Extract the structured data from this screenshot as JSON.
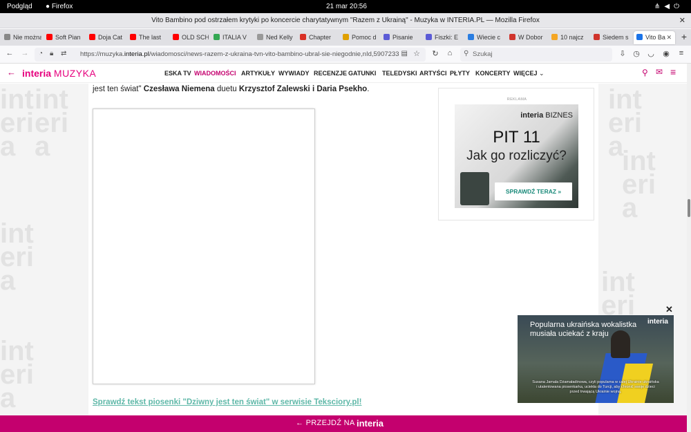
{
  "system": {
    "activities": "Podgląd",
    "app_name": "Firefox",
    "clock": "21 mar  20:56"
  },
  "window": {
    "title": "Vito Bambino pod ostrzałem krytyki po koncercie charytatywnym \"Razem z Ukrainą\" - Muzyka w INTERIA.PL — Mozilla Firefox",
    "close": "✕"
  },
  "tabs": [
    {
      "label": "Nie można p",
      "color": "#888888"
    },
    {
      "label": "Soft Pian",
      "color": "#ff0000"
    },
    {
      "label": "Doja Cat",
      "color": "#ff0000"
    },
    {
      "label": "The last",
      "color": "#ff0000"
    },
    {
      "label": "OLD SCH",
      "color": "#ff0000"
    },
    {
      "label": "ITALIA V",
      "color": "#34a853"
    },
    {
      "label": "Ned Kelly",
      "color": "#999999"
    },
    {
      "label": "Chapter",
      "color": "#d93025"
    },
    {
      "label": "Pomoc d",
      "color": "#e0a000"
    },
    {
      "label": "Pisanie",
      "color": "#5b5bd6"
    },
    {
      "label": "Fiszki: E",
      "color": "#5b5bd6"
    },
    {
      "label": "Wiecie c",
      "color": "#2a7de1"
    },
    {
      "label": "W Dobor",
      "color": "#d0342c"
    },
    {
      "label": "10 najcz",
      "color": "#f5a623"
    },
    {
      "label": "Siedem s",
      "color": "#d0342c"
    },
    {
      "label": "Vito Ba",
      "color": "#1a73e8",
      "active": true
    }
  ],
  "nav": {
    "url_prefix": "https://muzyka.",
    "url_host": "interia.pl",
    "url_rest": "/wiadomosci/news-razem-z-ukraina-tvn-vito-bambino-ubral-sie-niegodnie,nId,5907233",
    "search_placeholder": "Szukaj"
  },
  "site": {
    "logo_brand": "interia",
    "logo_section": "MUZYKA",
    "menu": [
      {
        "label": "ESKA TV"
      },
      {
        "label": "WIADOMOŚCI",
        "active": true
      },
      {
        "label": "ARTYKUŁY"
      },
      {
        "label": "WYWIADY"
      },
      {
        "label": "RECENZJE"
      },
      {
        "label": "GATUNKI"
      },
      {
        "label": "TELEDYSKI"
      },
      {
        "label": "ARTYŚCI"
      },
      {
        "label": "PŁYTY"
      },
      {
        "label": "KONCERTY"
      },
      {
        "label": "WIĘCEJ"
      }
    ]
  },
  "article": {
    "para_start": "jest ten świat\" ",
    "para_artist": "Czesława Niemena",
    "para_mid": " duetu ",
    "para_duo": "Krzysztof Zalewski i Daria Psekho",
    "para_end": ".",
    "lyrics_link": "Sprawdź tekst piosenki \"Dziwny jest ten świat\" w serwisie Teksciory.pl!"
  },
  "ad": {
    "label": "REKLAMA",
    "brand_a": "interia",
    "brand_b": "BIZNES",
    "headline": "PIT 11",
    "subheadline": "Jak go rozliczyć?",
    "cta": "SPRAWDŹ TERAZ »"
  },
  "video": {
    "title": "Popularna ukraińska wokalistka musiała uciekać z kraju",
    "logo": "interia",
    "subtitle": "Susana Jamala Dżamaładinowa, czyli popularna w całej Ukrainie ukraińska i utalentowana piosenkarka, uciekła do Turcji, aby chronić swoje dzieci przed trwającą Ukrainie wojną."
  },
  "bottom": {
    "label": "PRZEJDŹ NA",
    "logo": "interia"
  },
  "colors": {
    "accent": "#c4006e",
    "link": "#5fb8a8"
  }
}
